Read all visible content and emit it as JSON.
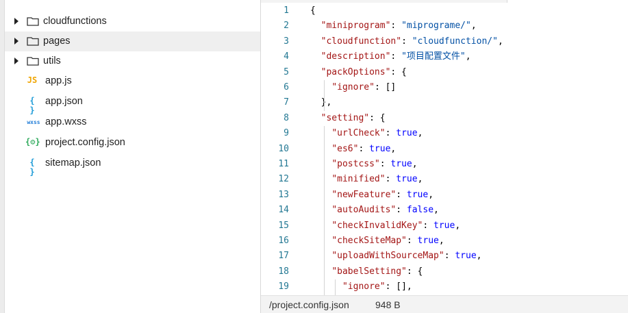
{
  "explorer": {
    "folders": [
      {
        "label": "cloudfunctions",
        "icon": "folder-icon",
        "selected": false
      },
      {
        "label": "pages",
        "icon": "folder-icon",
        "selected": true
      },
      {
        "label": "utils",
        "icon": "folder-icon",
        "selected": false
      }
    ],
    "files": [
      {
        "label": "app.js",
        "badge": "JS",
        "badge_color": "#f0a500",
        "icon": "js-file-icon"
      },
      {
        "label": "app.json",
        "badge": "{ }",
        "badge_color": "#1e9bd7",
        "icon": "json-file-icon"
      },
      {
        "label": "app.wxss",
        "badge": "wxss",
        "badge_color": "#1e7bd7",
        "icon": "wxss-file-icon"
      },
      {
        "label": "project.config.json",
        "badge": "{⚙}",
        "badge_color": "#2eaa5b",
        "icon": "config-file-icon"
      },
      {
        "label": "sitemap.json",
        "badge": "{ }",
        "badge_color": "#1e9bd7",
        "icon": "json-file-icon"
      }
    ]
  },
  "editor": {
    "lines": [
      {
        "n": "1",
        "tokens": [
          {
            "t": "{",
            "c": "p"
          }
        ]
      },
      {
        "n": "2",
        "tokens": [
          {
            "t": "  ",
            "c": "p"
          },
          {
            "t": "\"miniprogram\"",
            "c": "k"
          },
          {
            "t": ": ",
            "c": "p"
          },
          {
            "t": "\"miprograme/\"",
            "c": "s"
          },
          {
            "t": ",",
            "c": "p"
          }
        ]
      },
      {
        "n": "3",
        "tokens": [
          {
            "t": "  ",
            "c": "p"
          },
          {
            "t": "\"cloudfunction\"",
            "c": "k"
          },
          {
            "t": ": ",
            "c": "p"
          },
          {
            "t": "\"cloudfunction/\"",
            "c": "s"
          },
          {
            "t": ",",
            "c": "p"
          }
        ]
      },
      {
        "n": "4",
        "tokens": [
          {
            "t": "  ",
            "c": "p"
          },
          {
            "t": "\"description\"",
            "c": "k"
          },
          {
            "t": ": ",
            "c": "p"
          },
          {
            "t": "\"项目配置文件\"",
            "c": "s"
          },
          {
            "t": ",",
            "c": "p"
          }
        ]
      },
      {
        "n": "5",
        "tokens": [
          {
            "t": "  ",
            "c": "p"
          },
          {
            "t": "\"packOptions\"",
            "c": "k"
          },
          {
            "t": ": {",
            "c": "p"
          }
        ]
      },
      {
        "n": "6",
        "tokens": [
          {
            "t": "    ",
            "c": "p"
          },
          {
            "t": "\"ignore\"",
            "c": "k"
          },
          {
            "t": ": []",
            "c": "p"
          }
        ]
      },
      {
        "n": "7",
        "tokens": [
          {
            "t": "  },",
            "c": "p"
          }
        ]
      },
      {
        "n": "8",
        "tokens": [
          {
            "t": "  ",
            "c": "p"
          },
          {
            "t": "\"setting\"",
            "c": "k"
          },
          {
            "t": ": {",
            "c": "p"
          }
        ]
      },
      {
        "n": "9",
        "tokens": [
          {
            "t": "    ",
            "c": "p"
          },
          {
            "t": "\"urlCheck\"",
            "c": "k"
          },
          {
            "t": ": ",
            "c": "p"
          },
          {
            "t": "true",
            "c": "b"
          },
          {
            "t": ",",
            "c": "p"
          }
        ]
      },
      {
        "n": "10",
        "tokens": [
          {
            "t": "    ",
            "c": "p"
          },
          {
            "t": "\"es6\"",
            "c": "k"
          },
          {
            "t": ": ",
            "c": "p"
          },
          {
            "t": "true",
            "c": "b"
          },
          {
            "t": ",",
            "c": "p"
          }
        ]
      },
      {
        "n": "11",
        "tokens": [
          {
            "t": "    ",
            "c": "p"
          },
          {
            "t": "\"postcss\"",
            "c": "k"
          },
          {
            "t": ": ",
            "c": "p"
          },
          {
            "t": "true",
            "c": "b"
          },
          {
            "t": ",",
            "c": "p"
          }
        ]
      },
      {
        "n": "12",
        "tokens": [
          {
            "t": "    ",
            "c": "p"
          },
          {
            "t": "\"minified\"",
            "c": "k"
          },
          {
            "t": ": ",
            "c": "p"
          },
          {
            "t": "true",
            "c": "b"
          },
          {
            "t": ",",
            "c": "p"
          }
        ]
      },
      {
        "n": "13",
        "tokens": [
          {
            "t": "    ",
            "c": "p"
          },
          {
            "t": "\"newFeature\"",
            "c": "k"
          },
          {
            "t": ": ",
            "c": "p"
          },
          {
            "t": "true",
            "c": "b"
          },
          {
            "t": ",",
            "c": "p"
          }
        ]
      },
      {
        "n": "14",
        "tokens": [
          {
            "t": "    ",
            "c": "p"
          },
          {
            "t": "\"autoAudits\"",
            "c": "k"
          },
          {
            "t": ": ",
            "c": "p"
          },
          {
            "t": "false",
            "c": "b"
          },
          {
            "t": ",",
            "c": "p"
          }
        ]
      },
      {
        "n": "15",
        "tokens": [
          {
            "t": "    ",
            "c": "p"
          },
          {
            "t": "\"checkInvalidKey\"",
            "c": "k"
          },
          {
            "t": ": ",
            "c": "p"
          },
          {
            "t": "true",
            "c": "b"
          },
          {
            "t": ",",
            "c": "p"
          }
        ]
      },
      {
        "n": "16",
        "tokens": [
          {
            "t": "    ",
            "c": "p"
          },
          {
            "t": "\"checkSiteMap\"",
            "c": "k"
          },
          {
            "t": ": ",
            "c": "p"
          },
          {
            "t": "true",
            "c": "b"
          },
          {
            "t": ",",
            "c": "p"
          }
        ]
      },
      {
        "n": "17",
        "tokens": [
          {
            "t": "    ",
            "c": "p"
          },
          {
            "t": "\"uploadWithSourceMap\"",
            "c": "k"
          },
          {
            "t": ": ",
            "c": "p"
          },
          {
            "t": "true",
            "c": "b"
          },
          {
            "t": ",",
            "c": "p"
          }
        ]
      },
      {
        "n": "18",
        "tokens": [
          {
            "t": "    ",
            "c": "p"
          },
          {
            "t": "\"babelSetting\"",
            "c": "k"
          },
          {
            "t": ": {",
            "c": "p"
          }
        ]
      },
      {
        "n": "19",
        "tokens": [
          {
            "t": "      ",
            "c": "p"
          },
          {
            "t": "\"ignore\"",
            "c": "k"
          },
          {
            "t": ": [],",
            "c": "p"
          }
        ]
      }
    ]
  },
  "status_bar": {
    "path": "/project.config.json",
    "size": "948 B"
  }
}
